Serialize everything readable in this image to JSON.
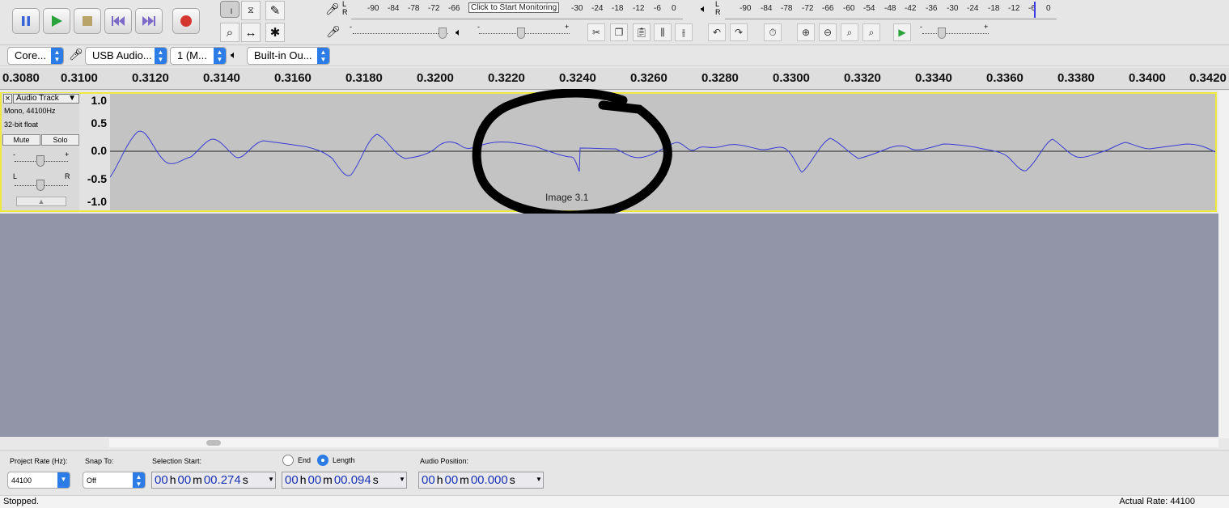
{
  "transport": {
    "buttons": [
      "pause-button",
      "play-button",
      "stop-button",
      "skip-start-button",
      "skip-end-button",
      "record-button"
    ]
  },
  "tools": [
    "selection-tool",
    "envelope-tool",
    "draw-tool",
    "zoom-tool",
    "timeshift-tool",
    "multi-tool"
  ],
  "record_meter": {
    "channel_l": "L",
    "channel_r": "R",
    "ticks": [
      "-90",
      "-84",
      "-78",
      "-72",
      "-66",
      "-30",
      "-24",
      "-18",
      "-12",
      "-6",
      "0"
    ],
    "monitor_label": "Click to Start Monitoring"
  },
  "play_meter": {
    "channel_l": "L",
    "channel_r": "R",
    "ticks": [
      "-90",
      "-84",
      "-78",
      "-72",
      "-66",
      "-60",
      "-54",
      "-48",
      "-42",
      "-36",
      "-30",
      "-24",
      "-18",
      "-12",
      "-6",
      "0"
    ]
  },
  "mixer": {
    "minus": "-",
    "plus": "+"
  },
  "devices": {
    "host": "Core...",
    "input": "USB Audio...",
    "channels": "1 (M...",
    "output": "Built-in Ou..."
  },
  "ruler": {
    "labels": [
      "0.3080",
      "0.3100",
      "0.3120",
      "0.3140",
      "0.3160",
      "0.3180",
      "0.3200",
      "0.3220",
      "0.3240",
      "0.3260",
      "0.3280",
      "0.3300",
      "0.3320",
      "0.3340",
      "0.3360",
      "0.3380",
      "0.3400",
      "0.3420"
    ]
  },
  "track": {
    "name": "Audio Track",
    "info1": "Mono, 44100Hz",
    "info2": "32-bit float",
    "mute": "Mute",
    "solo": "Solo",
    "gain_minus": "-",
    "gain_plus": "+",
    "pan_l": "L",
    "pan_r": "R",
    "close": "×",
    "menu_arrow": "▼",
    "collapse": "▲"
  },
  "vscale": [
    "1.0",
    "0.5",
    "0.0",
    "-0.5",
    "-1.0"
  ],
  "annotation": {
    "text": "Image 3.1"
  },
  "selection": {
    "rate_label": "Project Rate (Hz):",
    "rate_value": "44100",
    "snap_label": "Snap To:",
    "snap_value": "Off",
    "start_label": "Selection Start:",
    "end_label": "End",
    "length_label": "Length",
    "position_label": "Audio Position:",
    "start": {
      "h": "00",
      "m": "00",
      "s": "00.274"
    },
    "length": {
      "h": "00",
      "m": "00",
      "s": "00.094"
    },
    "position": {
      "h": "00",
      "m": "00",
      "s": "00.000"
    },
    "unit_h": "h",
    "unit_m": "m",
    "unit_s": "s"
  },
  "status": {
    "left": "Stopped.",
    "right": "Actual Rate: 44100"
  },
  "colors": {
    "waveform": "#3b3bd4",
    "track_selected_border": "#eeea3c",
    "timecode": "#1a33b3",
    "accent": "#2b7ce6"
  }
}
